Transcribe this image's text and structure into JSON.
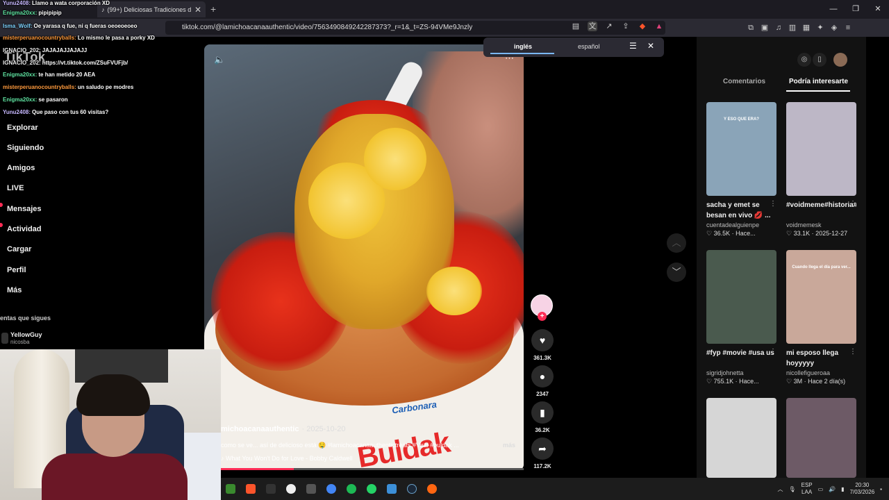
{
  "browser": {
    "tab_title": "(99+) Deliciosas Tradiciones d",
    "url": "tiktok.com/@lamichoacanaauthentic/video/7563490849242287373?_r=1&_t=ZS-94VMe9Jnzly",
    "window_controls": [
      "—",
      "❐",
      "✕"
    ]
  },
  "chat": [
    {
      "user": "Yunu2408:",
      "text": "Llamo a wata corporación XD",
      "color": "#c7b8ff"
    },
    {
      "user": "Enigma20xx:",
      "text": "pipipipip",
      "color": "#5fe3a1"
    },
    {
      "user": "Isma_Wolf:",
      "text": "Oe yarasa q fue, ni q fueras oeoeoeoeo",
      "color": "#7fd4ff"
    },
    {
      "user": "misterperuanocountryballs:",
      "text": "Lo mismo le pasa a porky XD",
      "color": "#ff9a3c"
    },
    {
      "user": "IGNACIO_202:",
      "text": "JAJAJAJJAJAJJ",
      "color": "#eaeaea"
    },
    {
      "user": "IGNACIO_202:",
      "text": "https://vt.tiktok.com/ZSuFVUFjb/",
      "color": "#eaeaea"
    },
    {
      "user": "Enigma20xx:",
      "text": "te han metido 20 AEA",
      "color": "#5fe3a1"
    },
    {
      "user": "misterperuanocountryballs:",
      "text": "un saludo pe modres",
      "color": "#ff9a3c"
    },
    {
      "user": "Enigma20xx:",
      "text": "se pasaron",
      "color": "#5fe3a1"
    },
    {
      "user": "Yunu2408:",
      "text": "Que paso con tus 60 visitas?",
      "color": "#c7b8ff"
    }
  ],
  "nav": {
    "logo": "TikTok",
    "items": [
      "Explorar",
      "Siguiendo",
      "Amigos",
      "LIVE",
      "Mensajes",
      "Actividad",
      "Cargar",
      "Perfil",
      "Más"
    ],
    "following_header": "entas que sigues",
    "following_user": "YellowGuy",
    "following_handle": "nicosba"
  },
  "translate": {
    "from": "inglés",
    "to": "español"
  },
  "video": {
    "author": "michoacanaauthentic",
    "date": "· 2025-10-20",
    "description": "como se ve... así de delicioso está 🤤 #lamichoacanaauthentictreats #Viral #buldak ...",
    "more": "más",
    "music": "What You Won't Do for Love - Bobby Caldwell",
    "progress": 0.28,
    "brand_top": "Carbonara",
    "brand_big": "Buldak"
  },
  "actions": {
    "likes": "361.3K",
    "comments": "2347",
    "saves": "36.2K",
    "shares": "117.2K"
  },
  "right": {
    "tabs": [
      "Comentarios",
      "Podría interesarte"
    ],
    "cards": [
      {
        "title": "sacha y emet se besan en vivo 💋 ...",
        "author": "cuentadealguienpe",
        "stat": "♡ 36.5K · Hace...",
        "bg": "#8aa4b8",
        "thumb_text": "Y ESO QUE ERA?"
      },
      {
        "title": "#voidmeme#historia#paratii",
        "author": "voidmemesk",
        "stat": "♡ 33.1K · 2025-12-27",
        "bg": "#bdb7c6",
        "thumb_text": ""
      },
      {
        "title": "#fyp #movie #usa us",
        "author": "sigridjohnetta",
        "stat": "♡ 755.1K · Hace...",
        "bg": "#4a5a4e",
        "thumb_text": ""
      },
      {
        "title": "mi esposo llega hoyyyyy",
        "author": "nicollefigueroaa",
        "stat": "♡ 3M · Hace 2 día(s)",
        "bg": "#c9a89a",
        "thumb_text": "Cuando llega el día para ver..."
      },
      {
        "title": "",
        "author": "",
        "stat": "",
        "bg": "#d6d6d6",
        "thumb_text": ""
      },
      {
        "title": "",
        "author": "",
        "stat": "",
        "bg": "#6d5a66",
        "thumb_text": ""
      }
    ]
  },
  "tray": {
    "lang1": "ESP",
    "lang2": "LAA",
    "time": "20:30",
    "date": "7/03/2026"
  }
}
